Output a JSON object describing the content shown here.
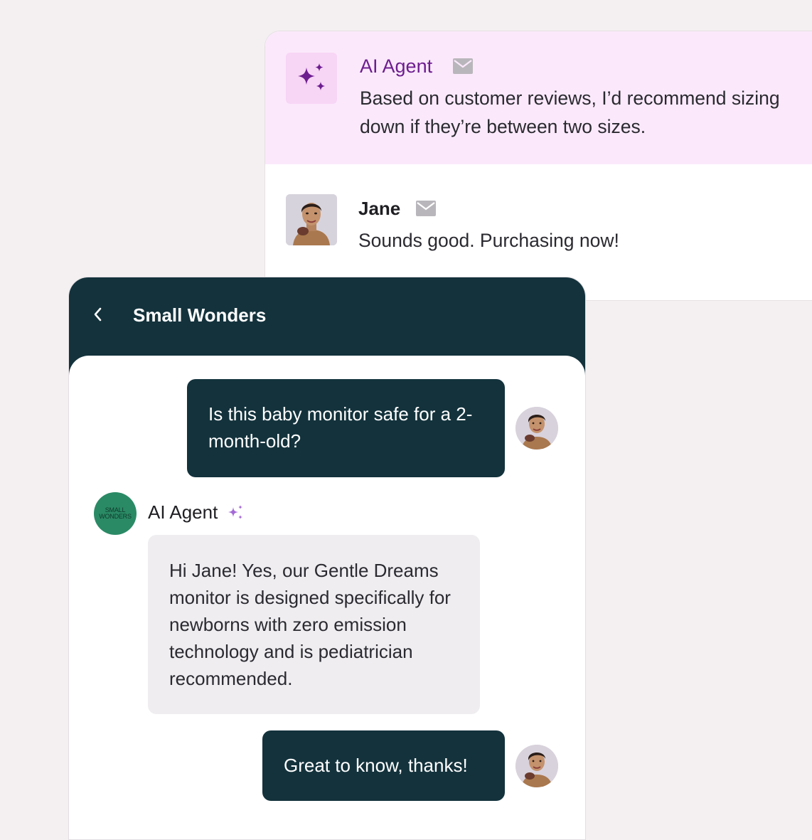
{
  "thread": {
    "ai_message": {
      "sender": "AI Agent",
      "icon": "sparkles-icon",
      "text": "Based on customer reviews, I’d recommend sizing down if they’re between two sizes."
    },
    "jane_message": {
      "sender": "Jane",
      "text": "Sounds good. Purchasing now!"
    }
  },
  "chat": {
    "title": "Small Wonders",
    "brand_avatar": {
      "line1": "SMALL",
      "line2": "WONDERS"
    },
    "messages": [
      {
        "role": "user",
        "text": "Is this baby monitor safe for a 2-month-old?"
      },
      {
        "role": "agent",
        "sender": "AI Agent",
        "text": "Hi Jane! Yes, our Gentle Dreams monitor is designed specifically for newborns with zero emission technology and is pediatrician recommended."
      },
      {
        "role": "user",
        "text": "Great to know, thanks!"
      }
    ]
  },
  "colors": {
    "background": "#f4f0f1",
    "ai_row": "#fbe9fb",
    "ai_accent": "#6d1e8f",
    "chat_header": "#13323c",
    "agent_bubble": "#efedf0",
    "brand": "#2a8a66"
  }
}
